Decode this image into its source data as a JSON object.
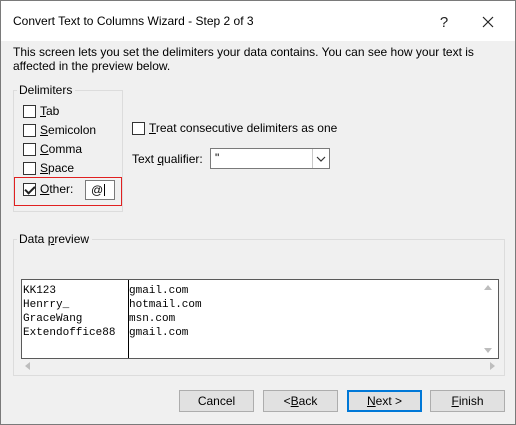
{
  "window": {
    "title": "Convert Text to Columns Wizard - Step 2 of 3",
    "help_label": "?",
    "close_label": "✕"
  },
  "intro": "This screen lets you set the delimiters your data contains.  You can see how your text is affected in the preview below.",
  "delimiters": {
    "group_label": "Delimiters",
    "items": [
      {
        "prefix": "",
        "hotkey": "T",
        "rest": "ab",
        "checked": false
      },
      {
        "prefix": "",
        "hotkey": "S",
        "rest": "emicolon",
        "checked": false
      },
      {
        "prefix": "",
        "hotkey": "C",
        "rest": "omma",
        "checked": false
      },
      {
        "prefix": "",
        "hotkey": "S",
        "rest": "pace",
        "checked": false
      },
      {
        "prefix": "",
        "hotkey": "O",
        "rest": "ther:",
        "checked": true
      }
    ],
    "other_value": "@"
  },
  "options": {
    "consecutive": {
      "hotkey": "T",
      "rest": "reat consecutive delimiters as one",
      "checked": false
    },
    "qualifier_prefix": "Text ",
    "qualifier_hotkey": "q",
    "qualifier_rest": "ualifier:",
    "qualifier_value": "\""
  },
  "preview": {
    "group_prefix": "Data ",
    "group_hotkey": "p",
    "group_rest": "review",
    "rows": [
      [
        "KK123",
        "gmail.com"
      ],
      [
        "Henrry_",
        "hotmail.com"
      ],
      [
        "GraceWang",
        "msn.com"
      ],
      [
        "Extendoffice88",
        "gmail.com"
      ]
    ]
  },
  "buttons": {
    "cancel": "Cancel",
    "back_prefix": "< ",
    "back_hotkey": "B",
    "back_rest": "ack",
    "next_hotkey": "N",
    "next_rest": "ext >",
    "finish_hotkey": "F",
    "finish_rest": "inish"
  }
}
